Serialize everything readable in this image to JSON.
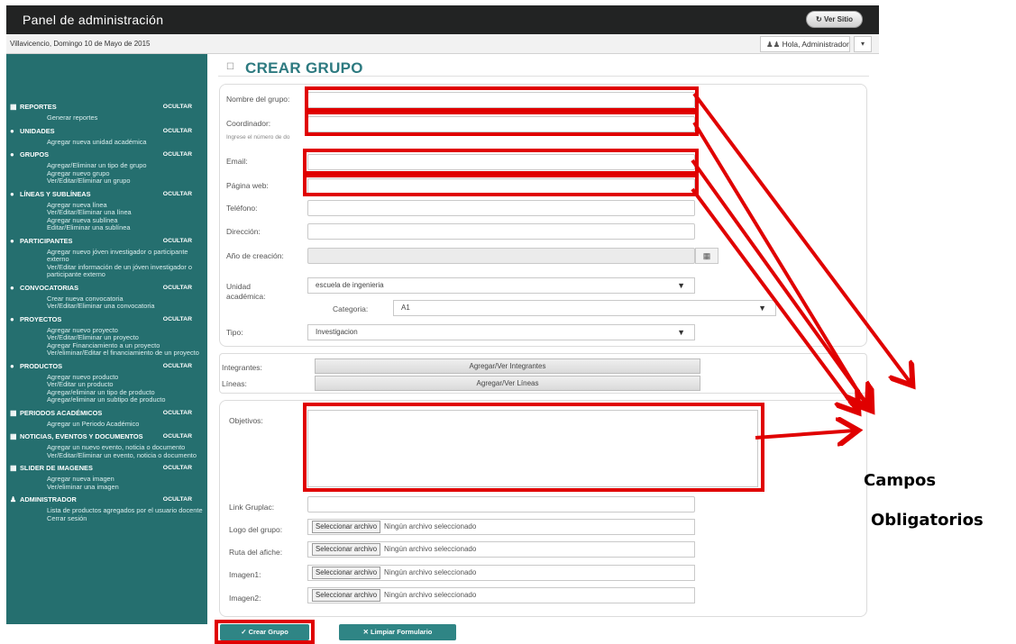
{
  "header": {
    "title": "Panel de administración",
    "ver_sitio": "Ver Sitio"
  },
  "datebar": {
    "date": "Villavicencio, Domingo 10 de Mayo de 2015",
    "user": "Hola, Administrador"
  },
  "sidebar": {
    "hide_label": "OCULTAR",
    "sections": [
      {
        "title": "REPORTES",
        "items": [
          "Generar reportes"
        ]
      },
      {
        "title": "UNIDADES",
        "items": [
          "Agregar nueva unidad académica"
        ]
      },
      {
        "title": "GRUPOS",
        "items": [
          "Agregar/Eliminar un tipo de grupo",
          "Agregar nuevo grupo",
          "Ver/Editar/Eliminar un grupo"
        ]
      },
      {
        "title": "LÍNEAS Y SUBLÍNEAS",
        "items": [
          "Agregar nueva línea",
          "Ver/Editar/Eliminar una línea",
          "Agregar nueva sublínea",
          "Editar/Eliminar una sublínea"
        ]
      },
      {
        "title": "PARTICIPANTES",
        "items": [
          "Agregar nuevo jóven investigador o participante externo",
          "Ver/Editar información de un jóven investigador o participante externo"
        ]
      },
      {
        "title": "CONVOCATORIAS",
        "items": [
          "Crear nueva convocatoria",
          "Ver/Editar/Eliminar una convocatoria"
        ]
      },
      {
        "title": "PROYECTOS",
        "items": [
          "Agregar nuevo proyecto",
          "Ver/Editar/Eliminar un proyecto",
          "Agregar Financiamiento a un proyecto",
          "Ver/eliminar/Editar el financiamiento de un proyecto"
        ]
      },
      {
        "title": "PRODUCTOS",
        "items": [
          "Agregar nuevo producto",
          "Ver/Editar un producto",
          "Agregar/eliminar un tipo de producto",
          "Agregar/eliminar un subtipo de producto"
        ]
      },
      {
        "title": "PERIODOS ACADÉMICOS",
        "items": [
          "Agregar un Periodo Académico"
        ]
      },
      {
        "title": "NOTICIAS, EVENTOS Y DOCUMENTOS",
        "items": [
          "Agregar un nuevo evento, noticia o documento",
          "Ver/Editar/Eliminar un evento, noticia o documento"
        ]
      },
      {
        "title": "SLIDER DE IMAGENES",
        "items": [
          "Agregar nueva imagen",
          "Ver/eliminar una imagen"
        ]
      },
      {
        "title": "ADMINISTRADOR",
        "items": [
          "Lista de productos agregados por el usuario docente",
          "Cerrar sesión"
        ]
      }
    ]
  },
  "page_title": "CREAR GRUPO",
  "form": {
    "nombre_label": "Nombre del grupo:",
    "coordinador_label": "Coordinador:",
    "coordinador_hint": "Ingrese el número de do",
    "email_label": "Email:",
    "web_label": "Página web:",
    "telefono_label": "Teléfono:",
    "direccion_label": "Dirección:",
    "anio_label": "Año de creación:",
    "unidad_label": "Unidad académica:",
    "unidad_value": "escuela de ingenieria",
    "categoria_label": "Categoria:",
    "categoria_value": "A1",
    "tipo_label": "Tipo:",
    "tipo_value": "Investigacion",
    "integrantes_label": "Integrantes:",
    "integrantes_button": "Agregar/Ver Integrantes",
    "lineas_label": "Líneas:",
    "lineas_button": "Agregar/Ver Líneas",
    "objetivos_label": "Objetivos:",
    "link_label": "Link Gruplac:",
    "logo_label": "Logo del grupo:",
    "afiche_label": "Ruta del afiche:",
    "imagen1_label": "Imagen1:",
    "imagen2_label": "Imagen2:",
    "file_button": "Seleccionar archivo",
    "file_none": "Ningún archivo seleccionado"
  },
  "actions": {
    "crear": "Crear Grupo",
    "limpiar": "Limpiar Formulario"
  },
  "annotation": {
    "line1": "Campos",
    "line2": "Obligatorios",
    "color": "#e00000"
  },
  "colors": {
    "sidebar": "#256f6f",
    "accent": "#2d7a80",
    "topbar": "#222323"
  }
}
